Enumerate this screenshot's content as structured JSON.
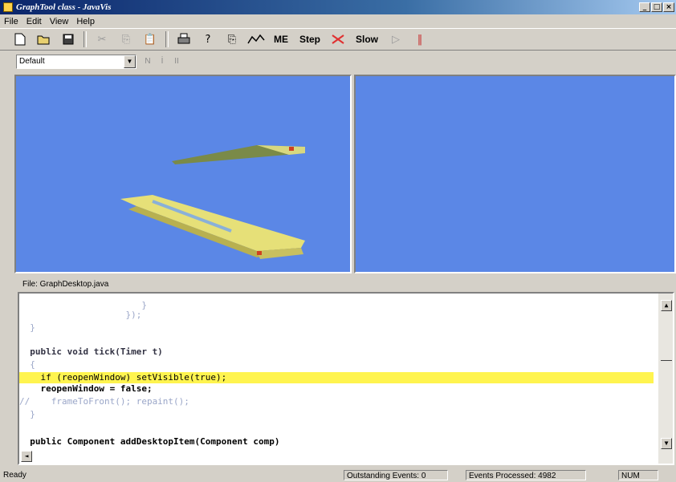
{
  "window": {
    "title": "GraphTool class - JavaVis",
    "buttons": [
      "_",
      "□",
      "×"
    ]
  },
  "menu": [
    "File",
    "Edit",
    "View",
    "Help"
  ],
  "toolbar": {
    "me_label": "ME",
    "step_label": "Step",
    "slow_label": "Slow",
    "icons": [
      "new-icon",
      "open-icon",
      "save-icon",
      "cut-icon",
      "copy-icon",
      "paste-icon",
      "print-icon",
      "help-icon",
      "export-icon",
      "graph-icon",
      "stop-icon",
      "play-icon",
      "pause-icon"
    ]
  },
  "options": {
    "view_select": "Default",
    "nav": [
      "N",
      "İ",
      "II"
    ]
  },
  "editor": {
    "file_label": "File: GraphDesktop.java",
    "lines": [
      {
        "text": "                       }",
        "style": "faint"
      },
      {
        "text": "                    });",
        "style": "faint"
      },
      {
        "text": "  }",
        "style": "faint"
      },
      {
        "text": "",
        "style": "faint"
      },
      {
        "text": "  public void tick(Timer t)",
        "style": "mixed"
      },
      {
        "text": "  {",
        "style": "faint"
      },
      {
        "text": "    if (reopenWindow) setVisible(true);",
        "style": "highlight"
      },
      {
        "text": "    reopenWindow = false;",
        "style": "mixed2"
      },
      {
        "text": "//    frameToFront(); repaint();",
        "style": "faint"
      },
      {
        "text": "  }",
        "style": "faint"
      },
      {
        "text": "",
        "style": "faint"
      },
      {
        "text": "  public Component addDesktopItem(Component comp)",
        "style": "mixed3"
      }
    ]
  },
  "status": {
    "ready": "Ready",
    "outstanding_label": "Outstanding Events:",
    "outstanding_value": "0",
    "processed_label": "Events Processed:",
    "processed_value": "4982",
    "num": "NUM"
  },
  "colors": {
    "viewport_bg": "#5b87e6",
    "highlight": "#fff44f",
    "title_bar": "#0a246a"
  }
}
